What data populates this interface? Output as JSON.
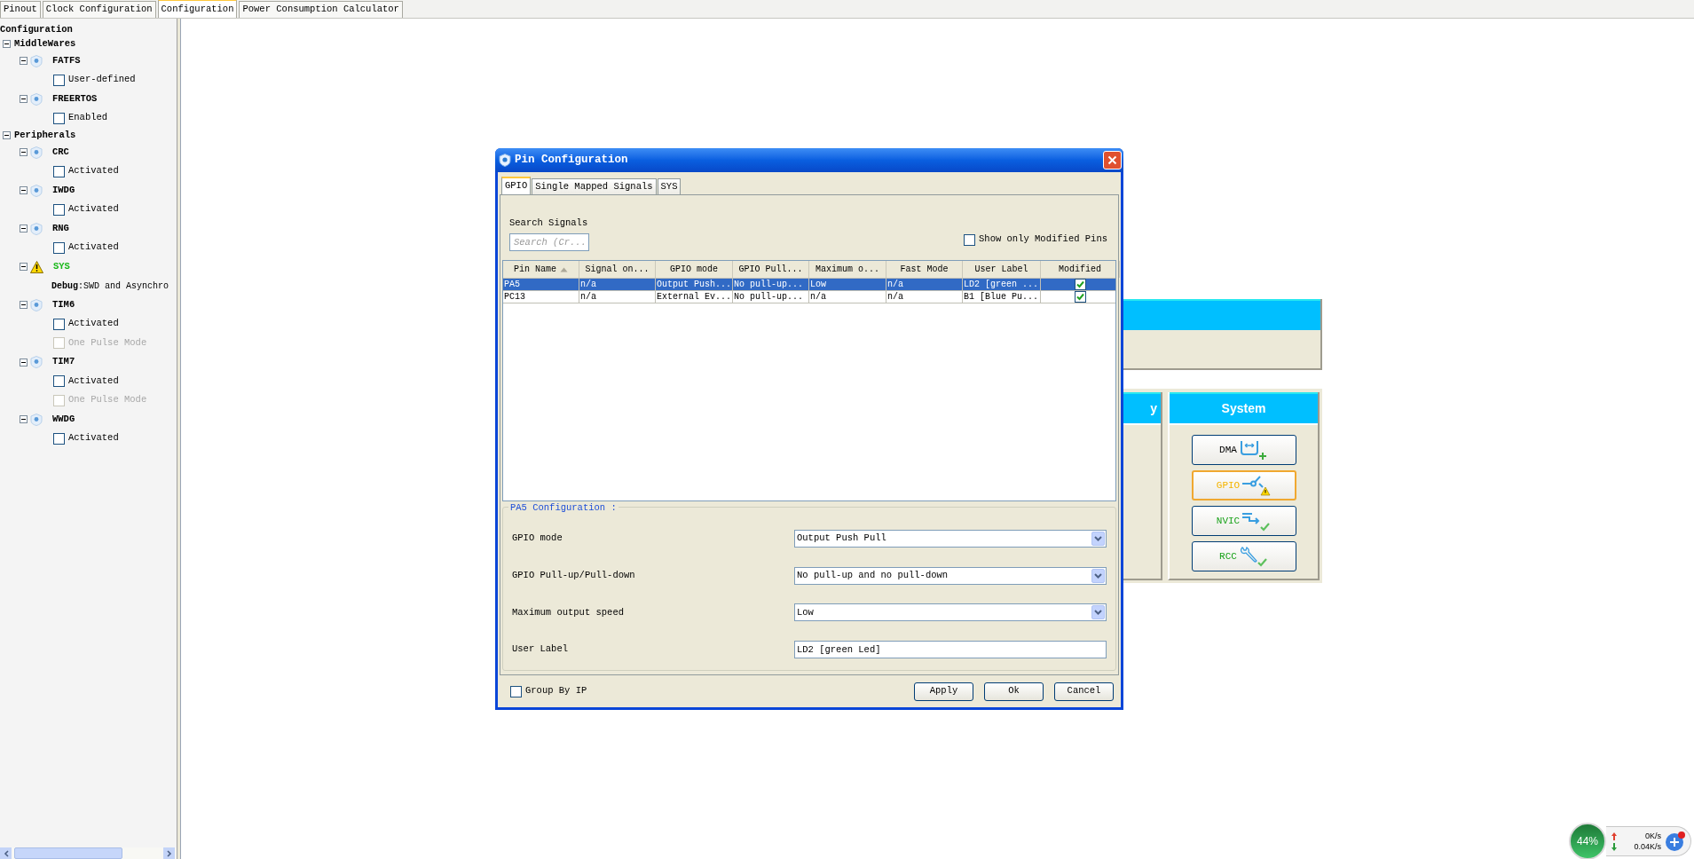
{
  "tabs": [
    {
      "label": "Pinout",
      "selected": false
    },
    {
      "label": "Clock Configuration",
      "selected": false
    },
    {
      "label": "Configuration",
      "selected": true
    },
    {
      "label": "Power Consumption Calculator",
      "selected": false
    }
  ],
  "tree": {
    "root": "Configuration",
    "children": [
      {
        "label": "MiddleWares",
        "expanded": true,
        "children": [
          {
            "label": "FATFS",
            "warning": false,
            "expanded": true,
            "children": [
              {
                "kind": "checkbox",
                "label": "User-defined",
                "checked": false,
                "disabled": false
              }
            ]
          },
          {
            "label": "FREERTOS",
            "warning": false,
            "expanded": true,
            "children": [
              {
                "kind": "checkbox",
                "label": "Enabled",
                "checked": false,
                "disabled": false
              }
            ]
          }
        ]
      },
      {
        "label": "Peripherals",
        "expanded": true,
        "children": [
          {
            "label": "CRC",
            "warning": false,
            "expanded": true,
            "children": [
              {
                "kind": "checkbox",
                "label": "Activated",
                "checked": false,
                "disabled": false
              }
            ]
          },
          {
            "label": "IWDG",
            "warning": false,
            "expanded": true,
            "children": [
              {
                "kind": "checkbox",
                "label": "Activated",
                "checked": false,
                "disabled": false
              }
            ]
          },
          {
            "label": "RNG",
            "warning": false,
            "expanded": true,
            "children": [
              {
                "kind": "checkbox",
                "label": "Activated",
                "checked": false,
                "disabled": false
              }
            ]
          },
          {
            "label": "SYS",
            "warning": true,
            "expanded": true,
            "children": [
              {
                "kind": "info",
                "text": "**Debug**:SWD and Asynchro"
              }
            ]
          },
          {
            "label": "TIM6",
            "warning": false,
            "expanded": true,
            "children": [
              {
                "kind": "checkbox",
                "label": "Activated",
                "checked": false,
                "disabled": false
              },
              {
                "kind": "checkbox",
                "label": "One Pulse Mode",
                "checked": false,
                "disabled": true
              }
            ]
          },
          {
            "label": "TIM7",
            "warning": false,
            "expanded": true,
            "children": [
              {
                "kind": "checkbox",
                "label": "Activated",
                "checked": false,
                "disabled": false
              },
              {
                "kind": "checkbox",
                "label": "One Pulse Mode",
                "checked": false,
                "disabled": true
              }
            ]
          },
          {
            "label": "WWDG",
            "warning": false,
            "expanded": true,
            "children": [
              {
                "kind": "checkbox",
                "label": "Activated",
                "checked": false,
                "disabled": false
              }
            ]
          }
        ]
      }
    ]
  },
  "background": {
    "connectivity_header": "y",
    "system": {
      "title": "System",
      "buttons": [
        {
          "label": "DMA",
          "kind": "new"
        },
        {
          "label": "GPIO",
          "kind": "warning"
        },
        {
          "label": "NVIC",
          "kind": "ok"
        },
        {
          "label": "RCC",
          "kind": "ok"
        }
      ]
    }
  },
  "dialog": {
    "title": "Pin Configuration",
    "tabs": [
      {
        "label": "GPIO",
        "selected": true
      },
      {
        "label": "Single Mapped Signals",
        "selected": false
      },
      {
        "label": "SYS",
        "selected": false
      }
    ],
    "search": {
      "label": "Search Signals",
      "placeholder": "Search (Cr..."
    },
    "show_modified": {
      "label": "Show only Modified Pins",
      "checked": false
    },
    "table": {
      "columns": [
        {
          "label": "Pin Name",
          "sorted": true
        },
        {
          "label": "Signal on...",
          "sorted": false
        },
        {
          "label": "GPIO mode",
          "sorted": false
        },
        {
          "label": "GPIO Pull...",
          "sorted": false
        },
        {
          "label": "Maximum o...",
          "sorted": false
        },
        {
          "label": "Fast Mode",
          "sorted": false
        },
        {
          "label": "User Label",
          "sorted": false
        },
        {
          "label": "Modified",
          "sorted": false
        }
      ],
      "rows": [
        {
          "selected": true,
          "cells": [
            "PA5",
            "n/a",
            "Output Push...",
            "No pull-up...",
            "Low",
            "n/a",
            "LD2 [green ..."
          ],
          "modified": true
        },
        {
          "selected": false,
          "cells": [
            "PC13",
            "n/a",
            "External Ev...",
            "No pull-up...",
            "n/a",
            "n/a",
            "B1 [Blue Pu..."
          ],
          "modified": true
        }
      ]
    },
    "config": {
      "title": "PA5 Configuration :",
      "fields": [
        {
          "kind": "select",
          "label": "GPIO mode",
          "value": "Output Push Pull"
        },
        {
          "kind": "select",
          "label": "GPIO Pull-up/Pull-down",
          "value": "No pull-up and no pull-down"
        },
        {
          "kind": "select",
          "label": "Maximum output speed",
          "value": "Low"
        },
        {
          "kind": "text",
          "label": "User Label",
          "value": "LD2 [green Led]"
        }
      ]
    },
    "group_by_ip": {
      "label": "Group By IP",
      "checked": false
    },
    "buttons": [
      "Apply",
      "Ok",
      "Cancel"
    ]
  },
  "net_monitor": {
    "load": "44%",
    "upload": "0K/s",
    "download": "0.04K/s"
  }
}
